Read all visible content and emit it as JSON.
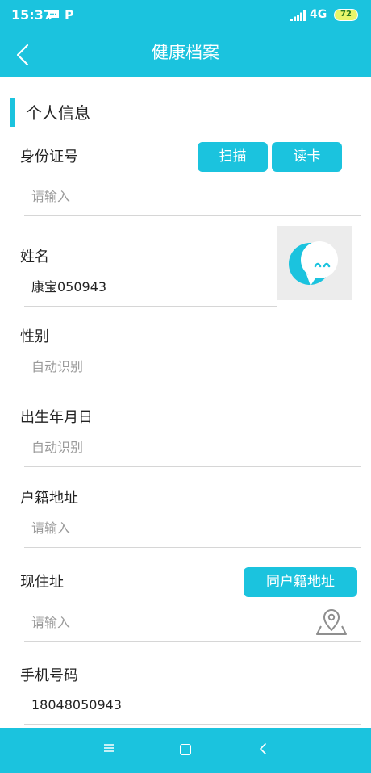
{
  "status": {
    "time": "15:37",
    "network": "4G",
    "battery": "72"
  },
  "header": {
    "title": "健康档案"
  },
  "section": {
    "title": "个人信息"
  },
  "id_card": {
    "label": "身份证号",
    "scan_label": "扫描",
    "read_label": "读卡",
    "placeholder": "请输入"
  },
  "name": {
    "label": "姓名",
    "value": "康宝050943"
  },
  "gender": {
    "label": "性别",
    "placeholder": "自动识别"
  },
  "birthdate": {
    "label": "出生年月日",
    "placeholder": "自动识别"
  },
  "household_address": {
    "label": "户籍地址",
    "placeholder": "请输入"
  },
  "current_address": {
    "label": "现住址",
    "same_button_label": "同户籍地址",
    "placeholder": "请输入"
  },
  "phone": {
    "label": "手机号码",
    "value": "18048050943"
  },
  "icons": {
    "back": "chevron-left-icon",
    "message": "message-icon",
    "signal": "signal-icon",
    "location": "location-pin-icon",
    "nav_menu": "menu-icon",
    "nav_home": "square-home-icon",
    "nav_back": "triangle-back-icon"
  },
  "colors": {
    "accent": "#1BC3DE",
    "placeholder": "#9a9a9a",
    "text": "#222222"
  }
}
